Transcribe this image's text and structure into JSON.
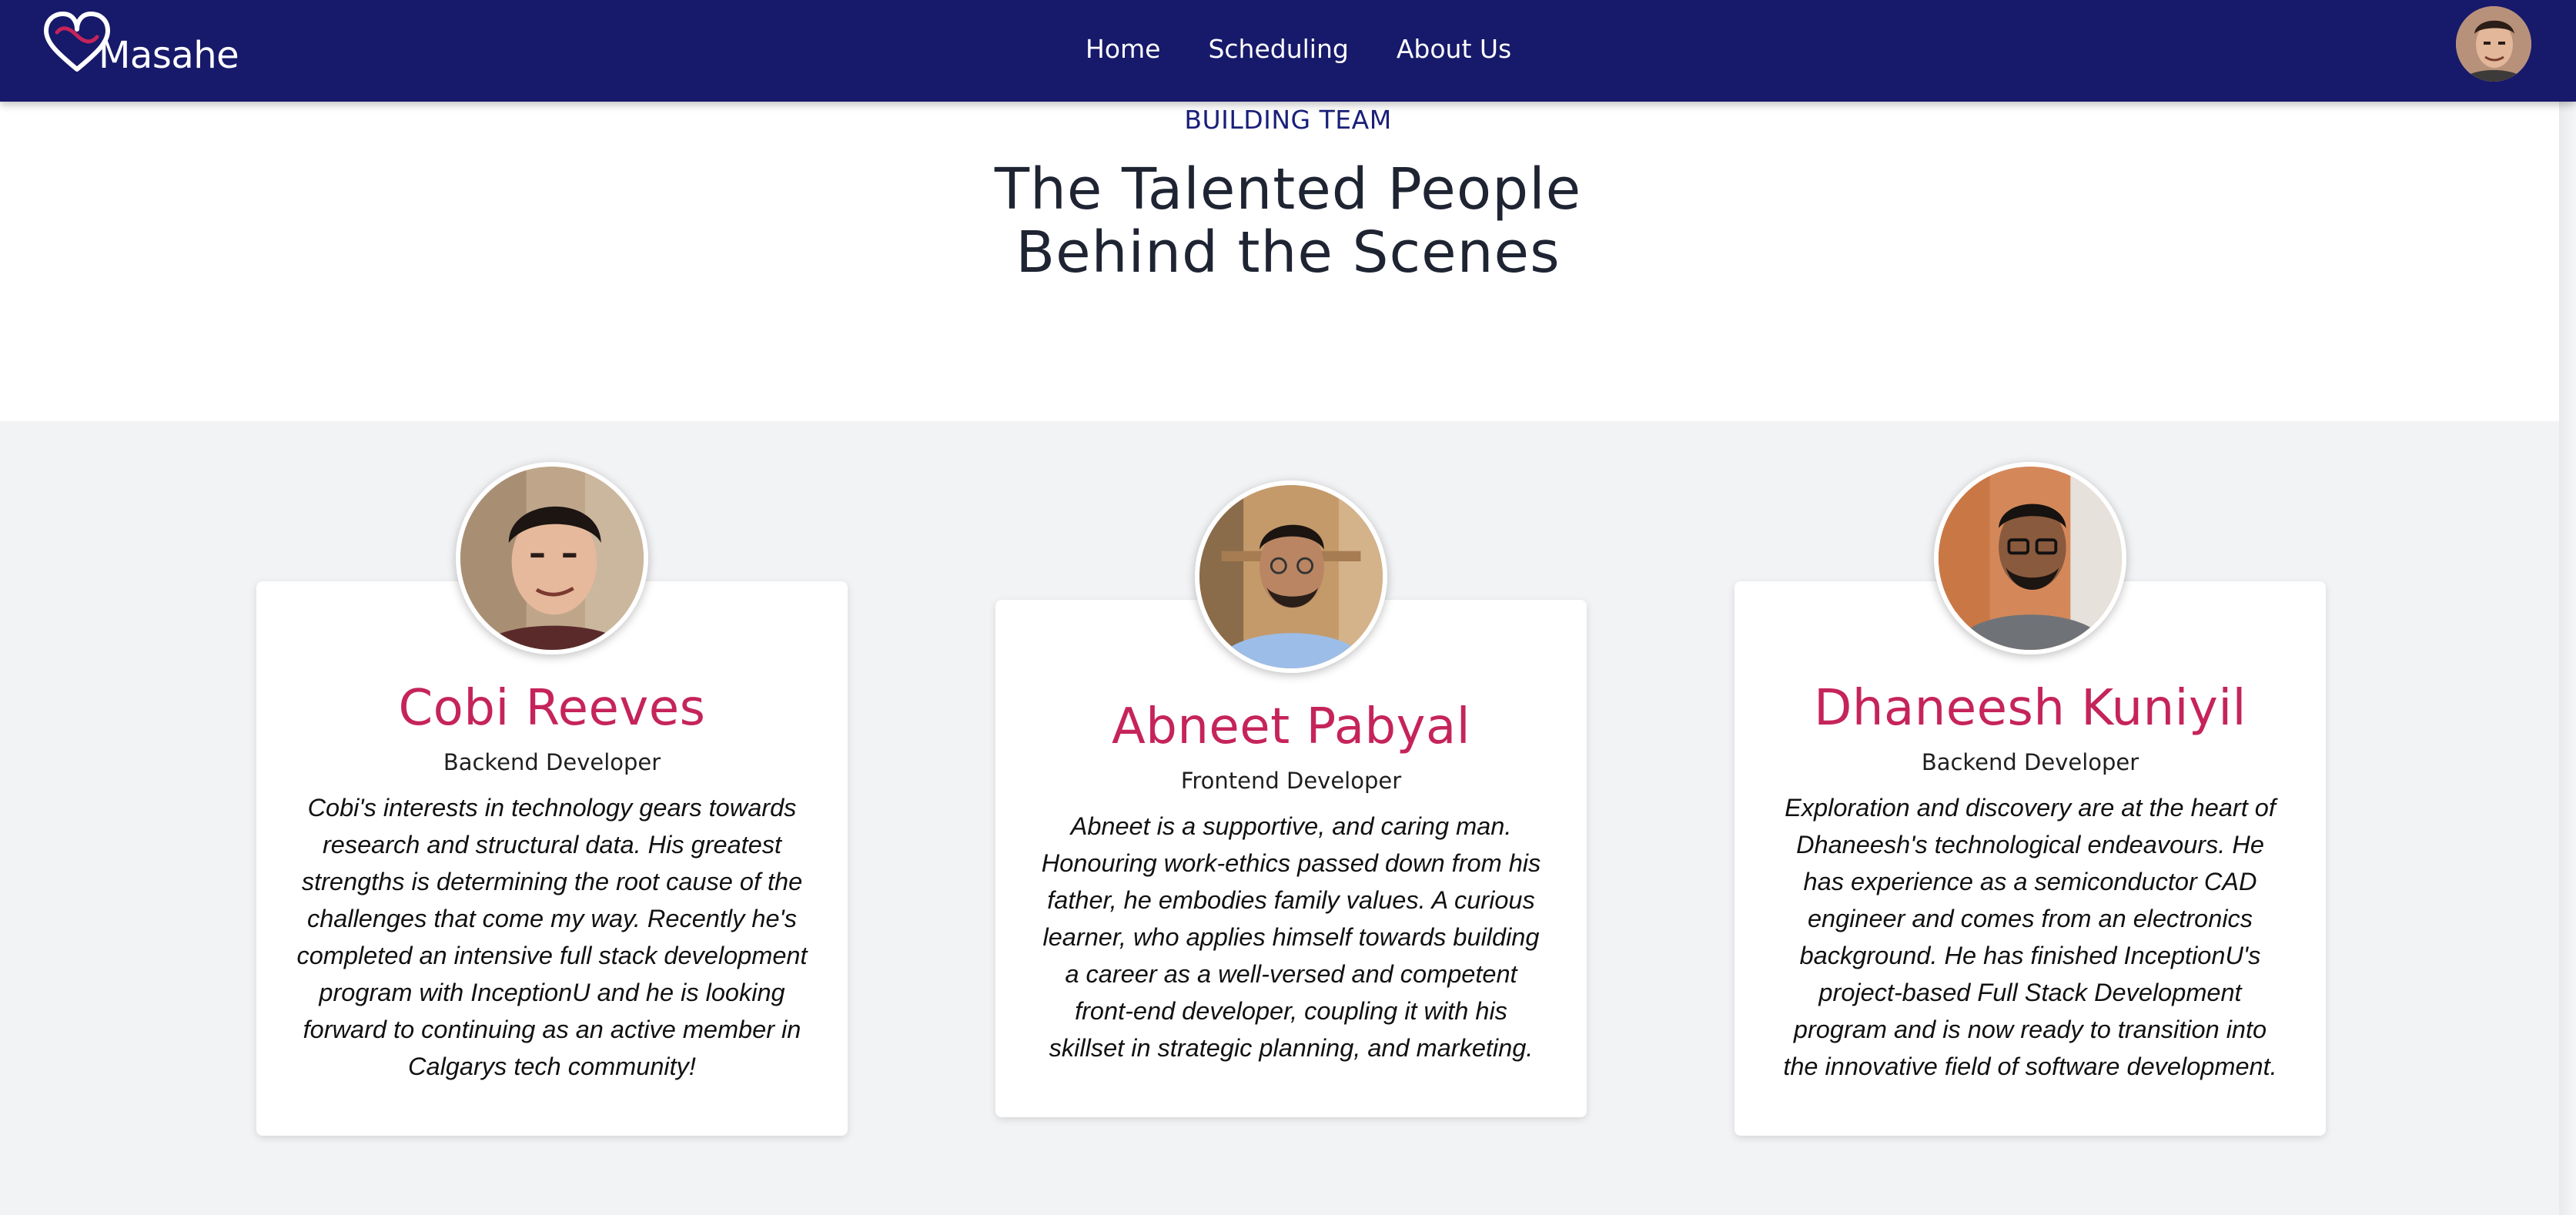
{
  "nav": {
    "brand": "Masahe",
    "links": [
      "Home",
      "Scheduling",
      "About Us"
    ]
  },
  "hero": {
    "eyebrow": "BUILDING TEAM",
    "title_line1": "The Talented People",
    "title_line2": "Behind the Scenes"
  },
  "team": [
    {
      "name": "Cobi Reeves",
      "role": "Backend Developer",
      "bio": "Cobi's interests in technology gears towards research and structural data. His greatest strengths is determining the root cause of the challenges that come my way. Recently he's completed an intensive full stack development program with InceptionU and he is looking forward to continuing as an active member in Calgarys tech community!"
    },
    {
      "name": "Abneet Pabyal",
      "role": "Frontend Developer",
      "bio": "Abneet is a supportive, and caring man. Honouring work-ethics passed down from his father, he embodies family values. A curious learner, who applies himself towards building a career as a well-versed and competent front-end developer, coupling it with his skillset in strategic planning, and marketing."
    },
    {
      "name": "Dhaneesh Kuniyil",
      "role": "Backend Developer",
      "bio": "Exploration and discovery are at the heart of Dhaneesh's technological endeavours. He has experience as a semiconductor CAD engineer and comes from an electronics background. He has finished InceptionU's project-based Full Stack Development program and is now ready to transition into the innovative field of software development."
    }
  ],
  "colors": {
    "navbar": "#17196a",
    "accent_name": "#c5245a",
    "eyebrow": "#1a1f7a",
    "section_bg": "#f2f3f5"
  },
  "icons": {
    "logo": "heart-infinity-icon",
    "user_avatar": "user-avatar"
  }
}
